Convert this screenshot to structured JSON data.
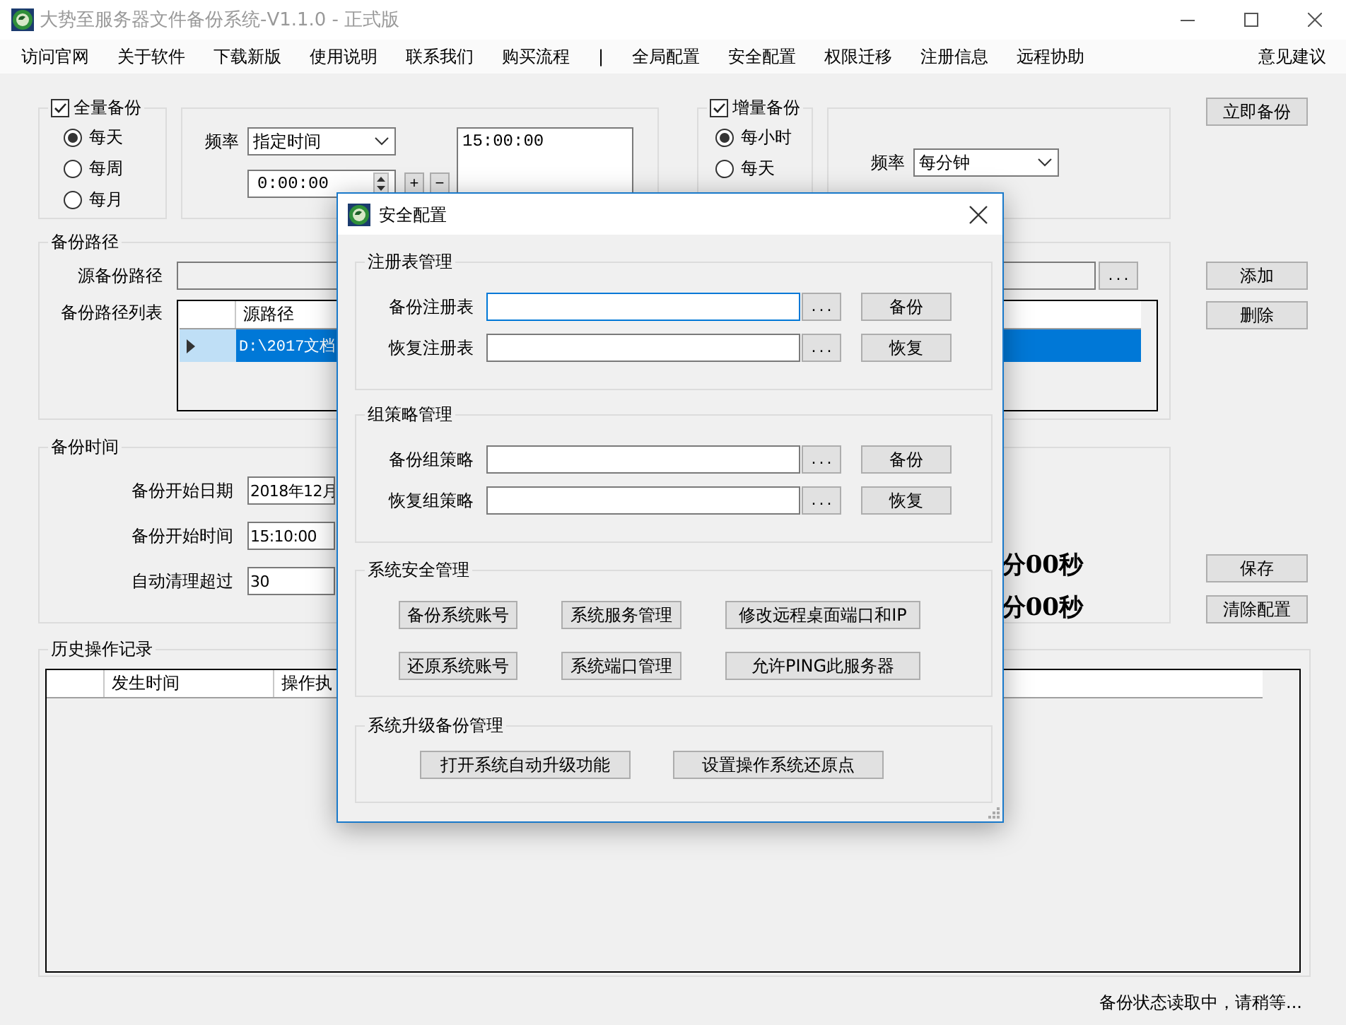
{
  "window": {
    "title": "大势至服务器文件备份系统-V1.1.0 - 正式版"
  },
  "menu": [
    {
      "label": "访问官网",
      "kind": "item"
    },
    {
      "label": "关于软件",
      "kind": "item"
    },
    {
      "label": "下载新版",
      "kind": "item"
    },
    {
      "label": "使用说明",
      "kind": "item"
    },
    {
      "label": "联系我们",
      "kind": "item"
    },
    {
      "label": "购买流程",
      "kind": "item"
    },
    {
      "label": "|",
      "kind": "separator"
    },
    {
      "label": "全局配置",
      "kind": "item"
    },
    {
      "label": "安全配置",
      "kind": "item"
    },
    {
      "label": "权限迁移",
      "kind": "item"
    },
    {
      "label": "注册信息",
      "kind": "item"
    },
    {
      "label": "远程协助",
      "kind": "item"
    },
    {
      "label": "意见建议",
      "kind": "end"
    }
  ],
  "full_backup": {
    "label": "全量备份",
    "checked": true,
    "options": [
      {
        "label": "每天",
        "selected": true
      },
      {
        "label": "每周",
        "selected": false
      },
      {
        "label": "每月",
        "selected": false
      }
    ],
    "frequency_label": "频率",
    "frequency": "指定时间",
    "time": "0:00:00",
    "add_time": "+",
    "remove_time": "−",
    "times": [
      "15:00:00"
    ]
  },
  "incremental_backup": {
    "label": "增量备份",
    "checked": true,
    "options": [
      {
        "label": "每小时",
        "selected": true
      },
      {
        "label": "每天",
        "selected": false
      }
    ],
    "frequency_label": "频率",
    "frequency": "每分钟"
  },
  "backup_now": "立即备份",
  "backup_paths": {
    "title": "备份路径",
    "source_label": "源备份路径",
    "browse": "...",
    "list_label": "备份路径列表",
    "columns": [
      "源路径"
    ],
    "rows": [
      {
        "path": "D:\\2017文档",
        "selected": true
      }
    ],
    "add": "添加",
    "delete": "删除"
  },
  "backup_time": {
    "title": "备份时间",
    "fields": [
      {
        "label": "备份开始日期",
        "value": "2018年12月"
      },
      {
        "label": "备份开始时间",
        "value": "15:10:00"
      },
      {
        "label": "自动清理超过",
        "value": "30"
      }
    ],
    "countdowns": [
      "分00秒",
      "分00秒"
    ],
    "save": "保存",
    "clear": "清除配置"
  },
  "history": {
    "title": "历史操作记录",
    "columns": [
      "发生时间",
      "操作执"
    ]
  },
  "status_bar": "备份状态读取中，请稍等...",
  "dialog": {
    "title": "安全配置",
    "groups": [
      {
        "title": "注册表管理",
        "kind": "files",
        "rows": [
          {
            "label": "备份注册表",
            "focused": true,
            "browse": "...",
            "action": "备份"
          },
          {
            "label": "恢复注册表",
            "focused": false,
            "browse": "...",
            "action": "恢复"
          }
        ]
      },
      {
        "title": "组策略管理",
        "kind": "files",
        "rows": [
          {
            "label": "备份组策略",
            "focused": false,
            "browse": "...",
            "action": "备份"
          },
          {
            "label": "恢复组策略",
            "focused": false,
            "browse": "...",
            "action": "恢复"
          }
        ]
      },
      {
        "title": "系统安全管理",
        "kind": "buttons",
        "rows": [
          [
            "备份系统账号",
            "系统服务管理",
            "修改远程桌面端口和IP"
          ],
          [
            "还原系统账号",
            "系统端口管理",
            "允许PING此服务器"
          ]
        ]
      },
      {
        "title": "系统升级备份管理",
        "kind": "buttons",
        "rows": [
          [
            "打开系统自动升级功能",
            "设置操作系统还原点"
          ]
        ]
      }
    ]
  }
}
